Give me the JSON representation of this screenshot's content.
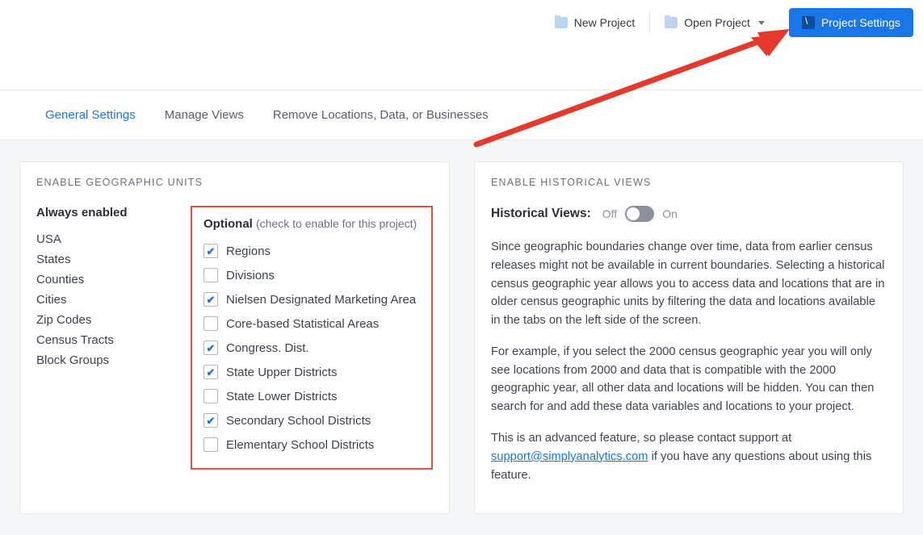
{
  "toolbar": {
    "new_project": "New Project",
    "open_project": "Open Project",
    "project_settings": "Project Settings"
  },
  "tabs": {
    "general": "General Settings",
    "manage_views": "Manage Views",
    "remove": "Remove Locations, Data, or Businesses"
  },
  "geo_card": {
    "title": "ENABLE GEOGRAPHIC UNITS",
    "always_label": "Always enabled",
    "always_items": [
      "USA",
      "States",
      "Counties",
      "Cities",
      "Zip Codes",
      "Census Tracts",
      "Block Groups"
    ],
    "optional_label": "Optional",
    "optional_hint": "(check to enable for this project)",
    "optional_items": [
      {
        "label": "Regions",
        "checked": true
      },
      {
        "label": "Divisions",
        "checked": false
      },
      {
        "label": "Nielsen Designated Marketing Area",
        "checked": true
      },
      {
        "label": "Core-based Statistical Areas",
        "checked": false
      },
      {
        "label": "Congress. Dist.",
        "checked": true
      },
      {
        "label": "State Upper Districts",
        "checked": true
      },
      {
        "label": "State Lower Districts",
        "checked": false
      },
      {
        "label": "Secondary School Districts",
        "checked": true
      },
      {
        "label": "Elementary School Districts",
        "checked": false
      }
    ]
  },
  "hist_card": {
    "title": "ENABLE HISTORICAL VIEWS",
    "row_label": "Historical Views:",
    "off": "Off",
    "on": "On",
    "toggle_state": false,
    "p1": "Since geographic boundaries change over time, data from earlier census releases might not be available in current boundaries. Selecting a historical census geographic year allows you to access data and locations that are in older census geographic units by filtering the data and locations available in the tabs on the left side of the screen.",
    "p2": "For example, if you select the 2000 census geographic year you will only see locations from 2000 and data that is compatible with the 2000 geographic year, all other data and locations will be hidden. You can then search for and add these data variables and locations to your project.",
    "p3_a": "This is an advanced feature, so please contact support at ",
    "p3_link": "support@simplyanalytics.com",
    "p3_b": " if you have any questions about using this feature."
  },
  "annotation": {
    "arrow_color": "#e5392d"
  }
}
